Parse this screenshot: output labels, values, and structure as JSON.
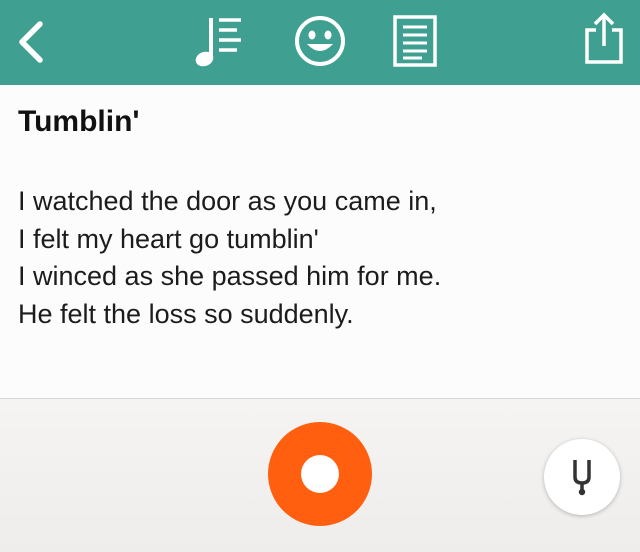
{
  "toolbar": {
    "background_color": "#3fa091",
    "back_icon": "chevron-left-icon",
    "tabs": [
      {
        "icon": "music-lyrics-icon",
        "active": true
      },
      {
        "icon": "smiley-face-icon",
        "active": false
      },
      {
        "icon": "document-icon",
        "active": false
      }
    ],
    "share_icon": "share-icon"
  },
  "song": {
    "title": "Tumblin'",
    "lyrics": [
      "I watched the door as you came in,",
      "I felt my heart go tumblin'",
      "I winced as she passed him for me.",
      "He felt the loss so suddenly."
    ]
  },
  "bottom_bar": {
    "record_icon": "record-icon",
    "record_color": "#ff5f0e",
    "tuner_icon": "tuning-fork-icon"
  }
}
